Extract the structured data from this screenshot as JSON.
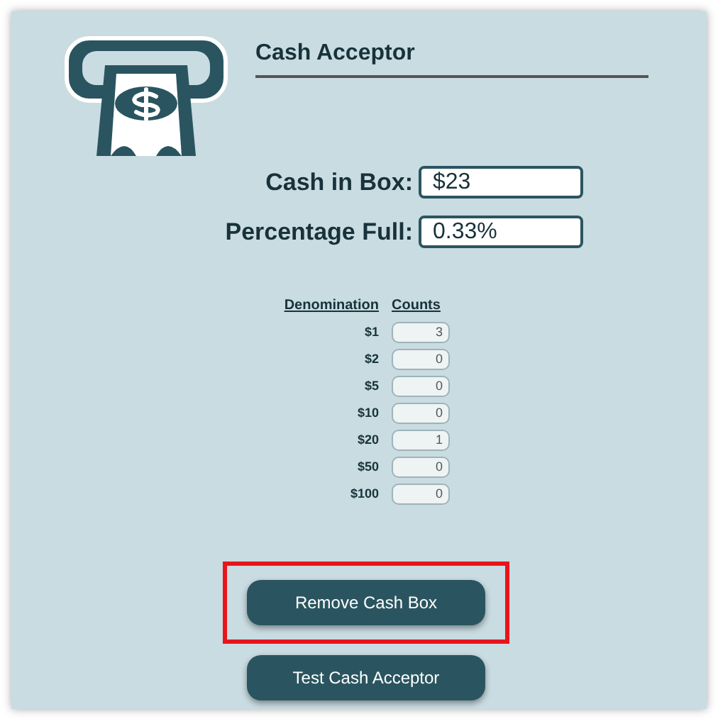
{
  "title": "Cash Acceptor",
  "fields": [
    {
      "label": "Cash in Box:",
      "value": "$23"
    },
    {
      "label": "Percentage Full:",
      "value": "0.33%"
    }
  ],
  "table": {
    "columns": [
      "Denomination",
      "Counts"
    ],
    "rows": [
      {
        "denomination": "$1",
        "count": "3"
      },
      {
        "denomination": "$2",
        "count": "0"
      },
      {
        "denomination": "$5",
        "count": "0"
      },
      {
        "denomination": "$10",
        "count": "0"
      },
      {
        "denomination": "$20",
        "count": "1"
      },
      {
        "denomination": "$50",
        "count": "0"
      },
      {
        "denomination": "$100",
        "count": "0"
      }
    ]
  },
  "buttons": [
    {
      "label": "Remove Cash Box",
      "highlighted": true
    },
    {
      "label": "Test Cash Acceptor",
      "highlighted": false
    }
  ]
}
